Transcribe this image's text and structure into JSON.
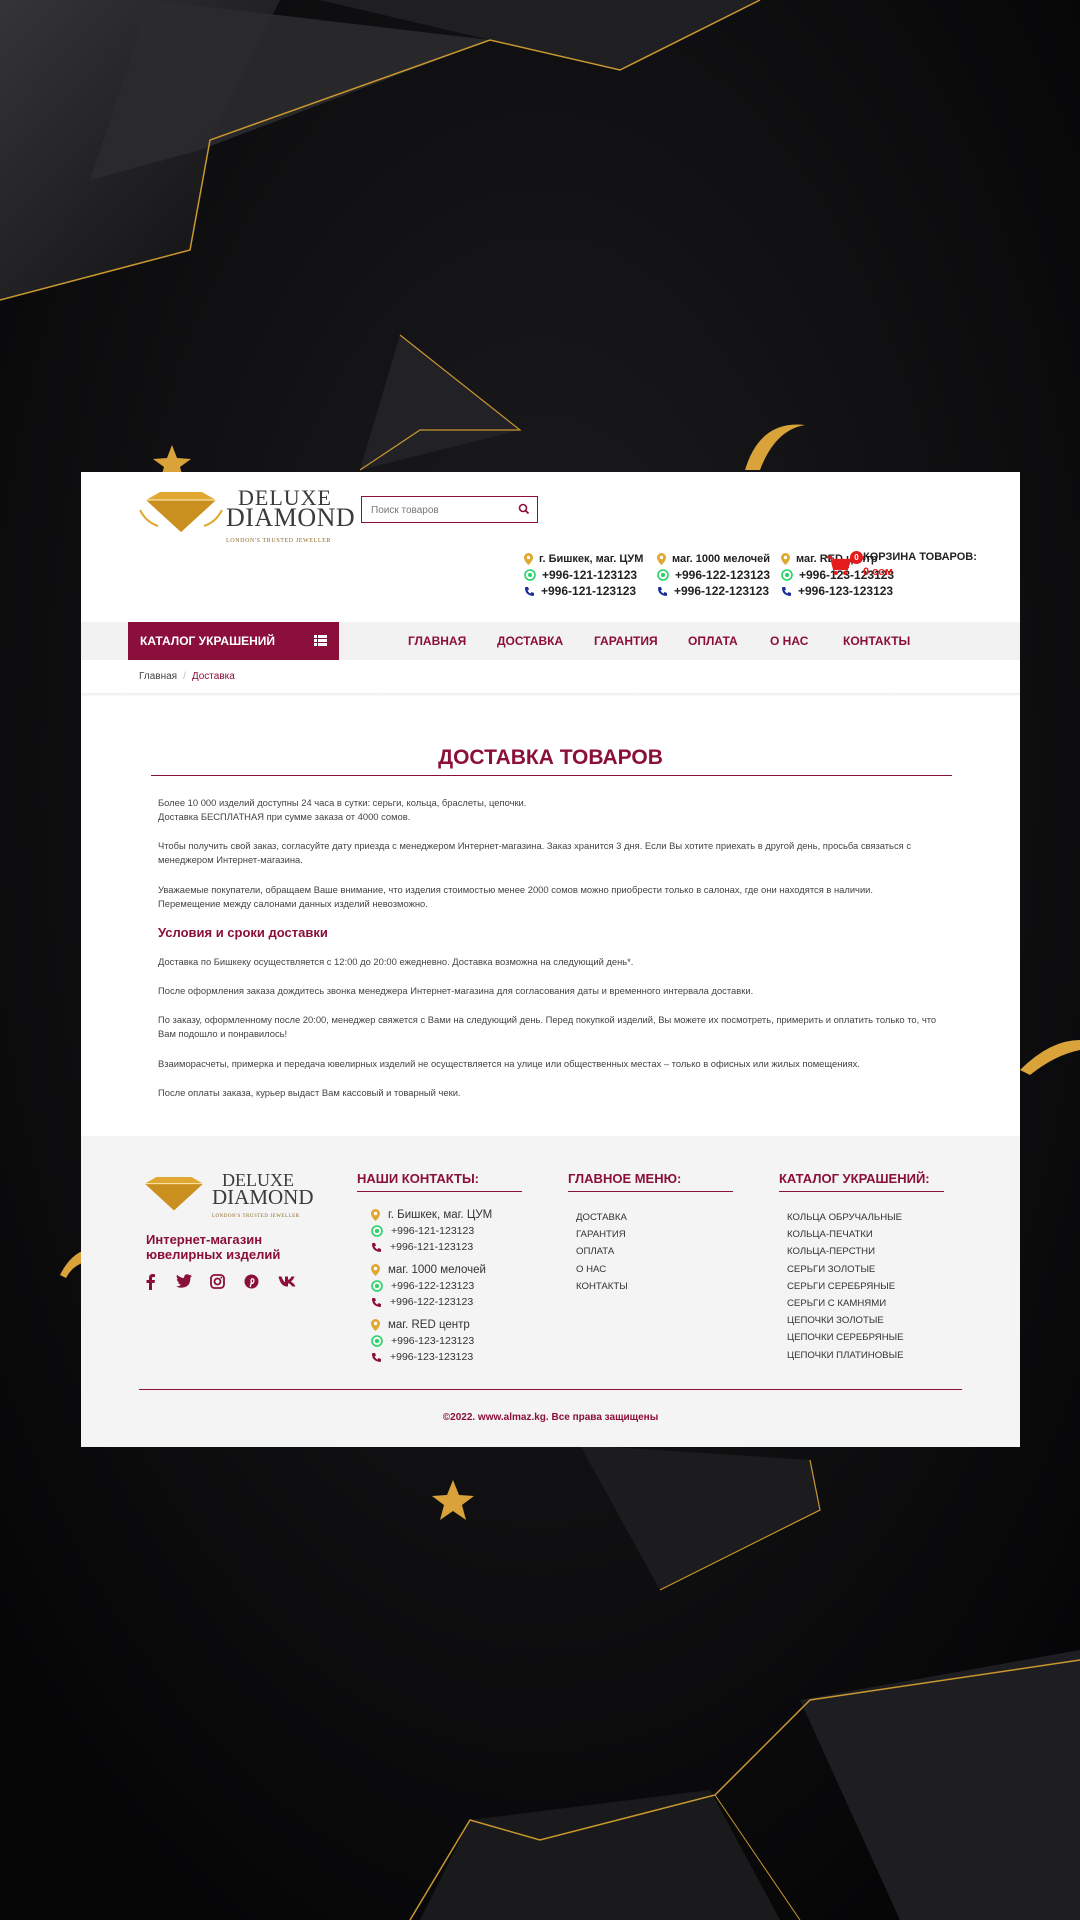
{
  "colors": {
    "brand": "#8b0f3b",
    "accent_gold": "#e0a830",
    "cart_red": "#e51c1c",
    "whatsapp": "#25d366",
    "phone_blue": "#1a2d9c"
  },
  "logo": {
    "line1": "DELUXE",
    "line2": "DIAMOND",
    "tagline": "LONDON'S TRUSTED JEWELLER"
  },
  "search": {
    "placeholder": "Поиск товаров",
    "icon": "search-icon"
  },
  "stores": [
    {
      "name": "г. Бишкек, маг. ЦУМ",
      "whatsapp": "+996-121-123123",
      "phone": "+996-121-123123"
    },
    {
      "name": "маг. 1000 мелочей",
      "whatsapp": "+996-122-123123",
      "phone": "+996-122-123123"
    },
    {
      "name": "маг. RED центр",
      "whatsapp": "+996-123-123123",
      "phone": "+996-123-123123"
    }
  ],
  "cart": {
    "count": "0",
    "title": "КОРЗИНА ТОВАРОВ:",
    "sum": "0 сом",
    "icon": "cart-icon"
  },
  "nav": {
    "catalog": "КАТАЛОГ УКРАШЕНИЙ",
    "items": [
      "ГЛАВНАЯ",
      "ДОСТАВКА",
      "ГАРАНТИЯ",
      "ОПЛАТА",
      "О НАС",
      "КОНТАКТЫ"
    ]
  },
  "breadcrumb": {
    "home": "Главная",
    "sep": "/",
    "current": "Доставка"
  },
  "content": {
    "title": "ДОСТАВКА ТОВАРОВ",
    "p1a": "Более 10 000 изделий доступны 24 часа в сутки: серьги, кольца, браслеты, цепочки.",
    "p1b": "Доставка БЕСПЛАТНАЯ  при сумме заказа от 4000 сомов.",
    "p2": "Чтобы получить свой заказ, согласуйте дату приезда с менеджером Интернет-магазина. Заказ хранится 3 дня. Если Вы хотите приехать в другой день, просьба связаться с менеджером Интернет-магазина.",
    "p3": "Уважаемые покупатели, обращаем Ваше внимание, что изделия стоимостью менее 2000 сомов можно приобрести только в салонах, где они находятся в наличии. Перемещение между салонами данных изделий невозможно.",
    "subtitle": "Условия и сроки доставки",
    "p4": "Доставка по Бишкеку осуществляется с 12:00 до 20:00 ежедневно. Доставка возможна на следующий день*.",
    "p5": "После оформления заказа дождитесь звонка менеджера Интернет-магазина для согласования даты и временного интервала доставки.",
    "p6": "По заказу, оформленному после 20:00, менеджер свяжется с Вами на следующий день. Перед покупкой изделий, Вы можете их посмотреть, примерить и оплатить только то, что Вам подошло и понравилось!",
    "p7": "Взаиморасчеты, примерка и передача ювелирных изделий не осуществляется на улице или общественных местах – только в офисных или жилых помещениях.",
    "p8": "После оплаты заказа, курьер выдаст Вам кассовый и товарный чеки."
  },
  "footer": {
    "tagline": "Интернет-магазин ювелирных изделий",
    "social": [
      "facebook-icon",
      "twitter-icon",
      "instagram-icon",
      "pinterest-icon",
      "vk-icon"
    ],
    "contacts_title": "НАШИ КОНТАКТЫ:",
    "menu_title": "ГЛАВНОЕ МЕНЮ:",
    "menu": [
      "ДОСТАВКА",
      "ГАРАНТИЯ",
      "ОПЛАТА",
      "О НАС",
      "КОНТАКТЫ"
    ],
    "catalog_title": "КАТАЛОГ УКРАШЕНИЙ:",
    "catalog": [
      "КОЛЬЦА ОБРУЧАЛЬНЫЕ",
      "КОЛЬЦА-ПЕЧАТКИ",
      "КОЛЬЦА-ПЕРСТНИ",
      "СЕРЬГИ ЗОЛОТЫЕ",
      "СЕРЬГИ СЕРЕБРЯНЫЕ",
      "СЕРЬГИ С КАМНЯМИ",
      "ЦЕПОЧКИ ЗОЛОТЫЕ",
      "ЦЕПОЧКИ СЕРЕБРЯНЫЕ",
      "ЦЕПОЧКИ ПЛАТИНОВЫЕ"
    ],
    "copyright": "©2022. www.almaz.kg. Все права защищены"
  }
}
